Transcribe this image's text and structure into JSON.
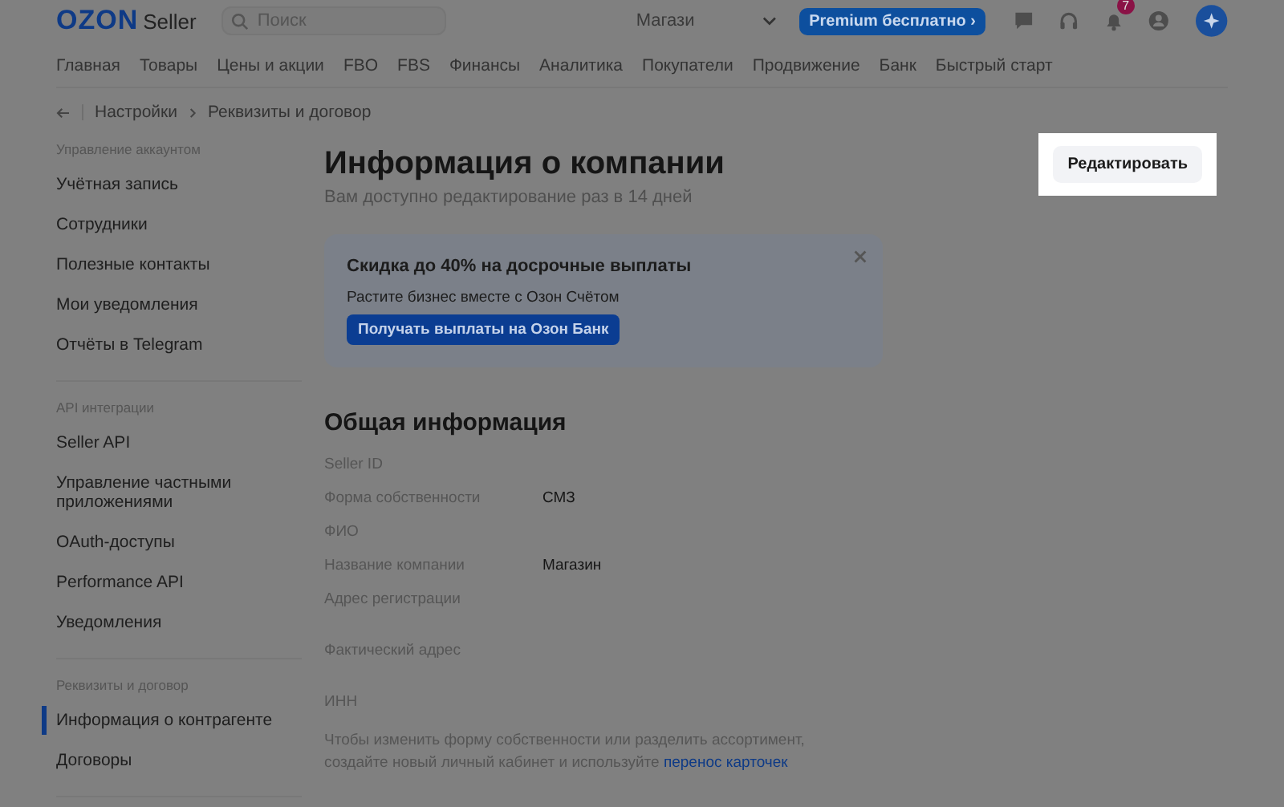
{
  "header": {
    "logo": "OZON",
    "logo_suffix": "Seller",
    "search": {
      "placeholder": "Поиск"
    },
    "store": "Магази",
    "premium": "Premium бесплатно ›",
    "notifications_badge": "7"
  },
  "nav": [
    {
      "label": "Главная"
    },
    {
      "label": "Товары"
    },
    {
      "label": "Цены и акции"
    },
    {
      "label": "FBO"
    },
    {
      "label": "FBS"
    },
    {
      "label": "Финансы"
    },
    {
      "label": "Аналитика"
    },
    {
      "label": "Покупатели"
    },
    {
      "label": "Продвижение"
    },
    {
      "label": "Банк"
    },
    {
      "label": "Быстрый старт"
    }
  ],
  "breadcrumbs": [
    "Настройки",
    "Реквизиты и договор"
  ],
  "sidebar": {
    "groups": [
      {
        "title": "Управление аккаунтом",
        "items": [
          {
            "label": "Учётная запись",
            "selected": false
          },
          {
            "label": "Сотрудники",
            "selected": false
          },
          {
            "label": "Полезные контакты",
            "selected": false
          },
          {
            "label": "Мои уведомления",
            "selected": false
          },
          {
            "label": "Отчёты в Telegram",
            "selected": false
          }
        ]
      },
      {
        "title": "API интеграции",
        "items": [
          {
            "label": "Seller API",
            "selected": false
          },
          {
            "label": "Управление частными приложениями",
            "selected": false
          },
          {
            "label": "OAuth-доступы",
            "selected": false
          },
          {
            "label": "Performance API",
            "selected": false
          },
          {
            "label": "Уведомления",
            "selected": false
          }
        ]
      },
      {
        "title": "Реквизиты и договор",
        "items": [
          {
            "label": "Информация о контрагенте",
            "selected": true
          },
          {
            "label": "Договоры",
            "selected": false
          }
        ]
      }
    ]
  },
  "page": {
    "title": "Информация о компании",
    "subtitle": "Вам доступно редактирование раз в 14 дней",
    "edit_button": "Редактировать"
  },
  "promo": {
    "title": "Скидка до 40% на досрочные выплаты",
    "text": "Растите бизнес вместе с Озон Счётом",
    "button": "Получать выплаты на Озон Банк"
  },
  "general": {
    "title": "Общая информация",
    "fields": [
      {
        "label": "Seller ID"
      },
      {
        "label": "Форма собственности",
        "value": "СМЗ"
      },
      {
        "label": "ФИО"
      },
      {
        "label": "Название компании",
        "value": "Магазин"
      },
      {
        "label": "Адрес регистрации",
        "tall": true
      },
      {
        "label": "Фактический адрес",
        "tall": true
      },
      {
        "label": "ИНН"
      }
    ],
    "note": "Чтобы изменить форму собственности или разделить ассортимент, создайте новый личный кабинет и используйте ",
    "note_link": "перенос карточек"
  }
}
